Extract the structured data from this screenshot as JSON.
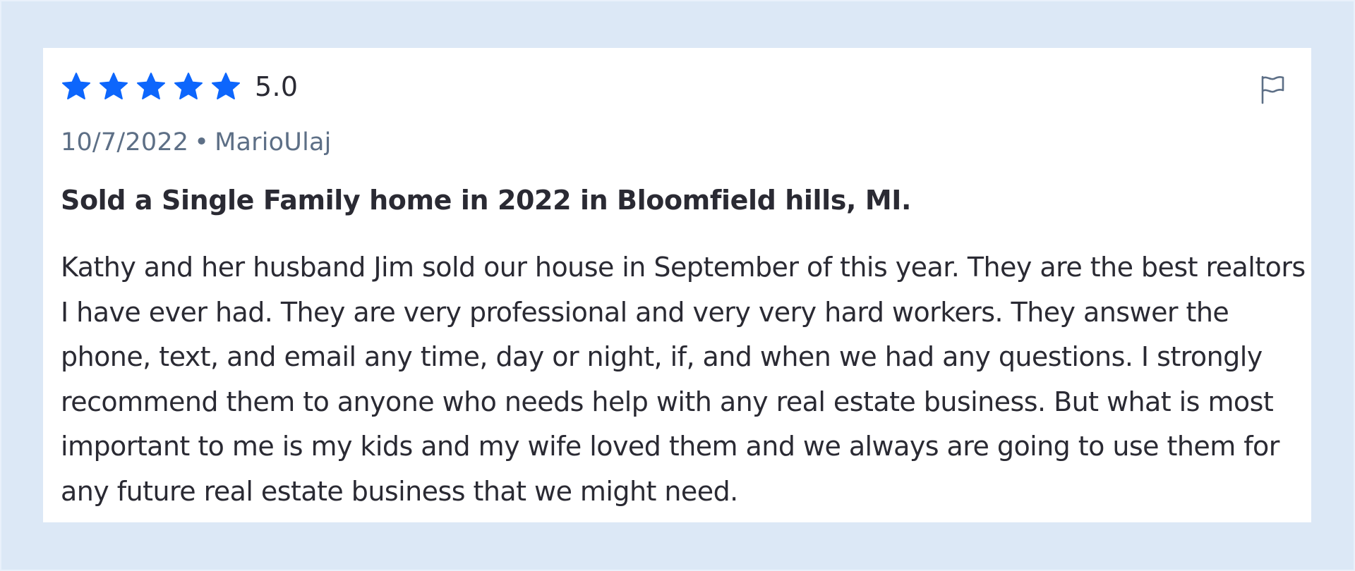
{
  "review": {
    "rating_value": 5,
    "rating_max": 5,
    "rating_text": "5.0",
    "star_color": "#0d66fc",
    "date": "10/7/2022",
    "separator": "•",
    "author": "MarioUlaj",
    "headline": "Sold a Single Family home in 2022 in Bloomfield hills, MI.",
    "body": "Kathy and her husband Jim sold our house in September of this year. They are the best realtors I have ever had. They are very professional and very very hard workers. They answer the phone, text, and email any time, day or night, if, and when we had any questions. I strongly recommend them to anyone who needs help with any real estate business. But what is most important to me is my kids and my wife loved them and we always are going to use them for any future real estate business that we might need.",
    "flag_icon": "flag-icon"
  }
}
